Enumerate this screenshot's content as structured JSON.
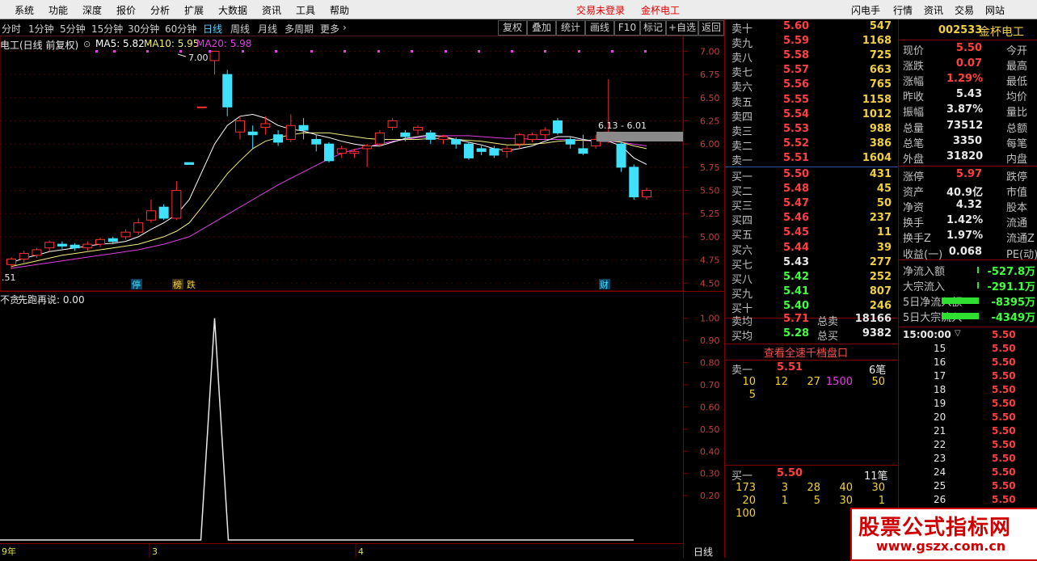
{
  "menu": {
    "items": [
      "系统",
      "功能",
      "深度",
      "报价",
      "分析",
      "扩展",
      "大数据",
      "资讯",
      "工具",
      "帮助"
    ],
    "status": [
      "交易未登录",
      "金杯电工"
    ],
    "right": [
      "闪电手",
      "行情",
      "资讯",
      "交易",
      "网站"
    ]
  },
  "toolbar": {
    "periods": [
      "分时",
      "1分钟",
      "5分钟",
      "15分钟",
      "30分钟",
      "60分钟",
      "日线",
      "周线",
      "月线",
      "多周期",
      "更多"
    ],
    "active": "日线",
    "buttons": [
      "复权",
      "叠加",
      "统计",
      "画线",
      "F10",
      "标记",
      "+自选",
      "返回"
    ]
  },
  "chart_header": {
    "name": "电工(日线 前复权)",
    "ma5": "MA5: 5.82",
    "ma10": "MA10: 5.95",
    "ma20": "MA20: 5.98",
    "high_label": "7.00",
    "range_label": "6.13 - 6.01",
    "low_label": ".51",
    "markers": [
      "停",
      "榜",
      "跌",
      "财"
    ]
  },
  "indicator": {
    "name": "不贪",
    "label": "先跑再说: 0.00",
    "period": "日线"
  },
  "x_axis": [
    "9年",
    "3",
    "4"
  ],
  "chart_data": [
    {
      "type": "candlestick",
      "y_ticks": [
        "7.00",
        "6.75",
        "6.50",
        "6.25",
        "6.00",
        "5.75",
        "5.50",
        "5.25",
        "5.00",
        "4.75",
        "4.50"
      ],
      "ylim": [
        4.45,
        7.1
      ],
      "candles": [
        [
          4.7,
          4.76,
          4.65,
          4.78
        ],
        [
          4.76,
          4.82,
          4.72,
          4.85
        ],
        [
          4.8,
          4.86,
          4.77,
          4.88
        ],
        [
          4.88,
          4.94,
          4.84,
          4.96
        ],
        [
          4.92,
          4.9,
          4.87,
          4.95
        ],
        [
          4.91,
          4.88,
          4.85,
          4.93
        ],
        [
          4.88,
          4.92,
          4.85,
          4.95
        ],
        [
          4.92,
          4.97,
          4.89,
          4.99
        ],
        [
          4.98,
          4.95,
          4.92,
          5.0
        ],
        [
          5.0,
          5.05,
          4.97,
          5.08
        ],
        [
          5.05,
          5.15,
          5.02,
          5.2
        ],
        [
          5.18,
          5.28,
          5.15,
          5.4
        ],
        [
          5.32,
          5.2,
          5.18,
          5.35
        ],
        [
          5.2,
          5.5,
          5.18,
          5.6
        ],
        [
          5.8,
          5.78,
          5.78,
          5.8
        ],
        [
          6.4,
          6.4,
          6.4,
          6.4
        ],
        [
          6.9,
          7.0,
          6.75,
          7.0
        ],
        [
          6.75,
          6.4,
          6.3,
          6.8
        ],
        [
          6.13,
          6.25,
          6.05,
          6.3
        ],
        [
          6.13,
          6.1,
          5.95,
          6.2
        ],
        [
          6.18,
          6.22,
          6.1,
          6.3
        ],
        [
          6.1,
          6.02,
          5.98,
          6.15
        ],
        [
          6.05,
          6.2,
          6.02,
          6.32
        ],
        [
          6.2,
          6.15,
          6.05,
          6.28
        ],
        [
          6.05,
          6.0,
          5.92,
          6.1
        ],
        [
          6.0,
          5.82,
          5.8,
          6.02
        ],
        [
          5.9,
          5.95,
          5.85,
          5.98
        ],
        [
          5.9,
          5.92,
          5.85,
          5.95
        ],
        [
          5.95,
          5.98,
          5.75,
          6.0
        ],
        [
          6.0,
          6.12,
          5.97,
          6.15
        ],
        [
          6.18,
          6.25,
          6.15,
          6.28
        ],
        [
          6.12,
          6.08,
          6.03,
          6.15
        ],
        [
          6.15,
          6.18,
          6.1,
          6.2
        ],
        [
          6.12,
          6.05,
          6.0,
          6.15
        ],
        [
          6.05,
          6.08,
          6.0,
          6.1
        ],
        [
          6.05,
          6.0,
          5.95,
          6.07
        ],
        [
          6.0,
          5.85,
          5.83,
          6.02
        ],
        [
          5.95,
          5.92,
          5.88,
          5.98
        ],
        [
          5.95,
          5.88,
          5.85,
          5.98
        ],
        [
          5.92,
          5.95,
          5.85,
          5.98
        ],
        [
          6.0,
          6.1,
          5.95,
          6.12
        ],
        [
          6.05,
          6.1,
          6.02,
          6.12
        ],
        [
          6.1,
          6.15,
          6.05,
          6.18
        ],
        [
          6.25,
          6.12,
          6.1,
          6.28
        ],
        [
          6.05,
          6.0,
          5.95,
          6.08
        ],
        [
          5.95,
          5.9,
          5.88,
          6.1
        ],
        [
          5.98,
          6.05,
          5.95,
          6.1
        ],
        [
          6.05,
          6.13,
          6.01,
          6.7
        ],
        [
          6.0,
          5.75,
          5.7,
          6.02
        ],
        [
          5.75,
          5.43,
          5.4,
          5.78
        ],
        [
          5.43,
          5.5,
          5.4,
          5.53
        ]
      ],
      "ma5": [
        4.72,
        4.77,
        4.8,
        4.84,
        4.86,
        4.88,
        4.9,
        4.92,
        4.93,
        4.95,
        5.0,
        5.08,
        5.15,
        5.24,
        5.4,
        5.7,
        6.0,
        6.2,
        6.3,
        6.32,
        6.28,
        6.2,
        6.16,
        6.14,
        6.1,
        6.07,
        6.03,
        6.0,
        5.98,
        5.98,
        6.02,
        6.06,
        6.08,
        6.1,
        6.08,
        6.05,
        6.02,
        5.99,
        5.95,
        5.93,
        5.95,
        5.98,
        6.03,
        6.08,
        6.08,
        6.05,
        6.03,
        6.03,
        5.98,
        5.85,
        5.78
      ],
      "ma10": [
        4.68,
        4.71,
        4.74,
        4.77,
        4.8,
        4.82,
        4.84,
        4.86,
        4.88,
        4.9,
        4.92,
        4.96,
        5.0,
        5.06,
        5.15,
        5.32,
        5.5,
        5.68,
        5.82,
        5.95,
        6.03,
        6.07,
        6.1,
        6.12,
        6.12,
        6.12,
        6.1,
        6.08,
        6.06,
        6.05,
        6.05,
        6.05,
        6.05,
        6.06,
        6.06,
        6.05,
        6.04,
        6.03,
        6.01,
        5.99,
        5.99,
        6.0,
        6.01,
        6.03,
        6.04,
        6.04,
        6.04,
        6.04,
        6.02,
        5.98,
        5.95
      ],
      "ma20": [
        4.66,
        4.68,
        4.7,
        4.72,
        4.74,
        4.76,
        4.78,
        4.8,
        4.82,
        4.84,
        4.86,
        4.89,
        4.92,
        4.96,
        5.0,
        5.08,
        5.16,
        5.24,
        5.32,
        5.4,
        5.48,
        5.56,
        5.63,
        5.7,
        5.77,
        5.84,
        5.9,
        5.94,
        5.97,
        6.0,
        6.03,
        6.05,
        6.07,
        6.08,
        6.09,
        6.09,
        6.09,
        6.08,
        6.07,
        6.06,
        6.06,
        6.05,
        6.05,
        6.05,
        6.05,
        6.04,
        6.03,
        6.03,
        6.02,
        6.0,
        5.98
      ]
    },
    {
      "type": "line",
      "y_ticks": [
        "1.00",
        "0.90",
        "0.80",
        "0.70",
        "0.60",
        "0.50",
        "0.40",
        "0.30",
        "0.20"
      ],
      "ylim": [
        0,
        1.05
      ],
      "values": [
        0,
        0,
        0,
        0,
        0,
        0,
        0,
        0,
        0,
        0,
        0,
        0,
        0,
        0,
        0,
        0,
        1,
        0,
        0,
        0,
        0,
        0,
        0,
        0,
        0,
        0,
        0,
        0,
        0,
        0,
        0,
        0,
        0,
        0,
        0,
        0,
        0,
        0,
        0,
        0,
        0,
        0,
        0,
        0,
        0,
        0
      ]
    }
  ],
  "orderbook": {
    "sell": [
      [
        "卖十",
        "5.60",
        "547"
      ],
      [
        "卖九",
        "5.59",
        "1168"
      ],
      [
        "卖八",
        "5.58",
        "725"
      ],
      [
        "卖七",
        "5.57",
        "663"
      ],
      [
        "卖六",
        "5.56",
        "765"
      ],
      [
        "卖五",
        "5.55",
        "1158"
      ],
      [
        "卖四",
        "5.54",
        "1012"
      ],
      [
        "卖三",
        "5.53",
        "988"
      ],
      [
        "卖二",
        "5.52",
        "386"
      ],
      [
        "卖一",
        "5.51",
        "1604"
      ]
    ],
    "buy": [
      [
        "买一",
        "5.50",
        "431"
      ],
      [
        "买二",
        "5.48",
        "45"
      ],
      [
        "买三",
        "5.47",
        "50"
      ],
      [
        "买四",
        "5.46",
        "237"
      ],
      [
        "买五",
        "5.45",
        "11"
      ],
      [
        "买六",
        "5.44",
        "39"
      ],
      [
        "买七",
        "5.43",
        "277"
      ],
      [
        "买八",
        "5.42",
        "252"
      ],
      [
        "买九",
        "5.41",
        "807"
      ],
      [
        "买十",
        "5.40",
        "246"
      ]
    ],
    "avg": [
      [
        "卖均",
        "5.71",
        "总卖",
        "18166"
      ],
      [
        "买均",
        "5.28",
        "总买",
        "9382"
      ]
    ],
    "view_all": "查看全速千档盘口",
    "sell1_queue": {
      "label": "卖一",
      "price": "5.51",
      "count": "6笔",
      "orders": [
        "10",
        "12",
        "27",
        "1500",
        "50",
        "5"
      ]
    },
    "buy1_queue": {
      "label": "买一",
      "price": "5.50",
      "count": "11笔",
      "orders": [
        "173",
        "3",
        "28",
        "40",
        "30",
        "20",
        "1",
        "5",
        "30",
        "1",
        "100"
      ]
    }
  },
  "quote": {
    "code": "002533",
    "name": "金杯电工",
    "rows": [
      [
        "现价",
        "5.50",
        "今开"
      ],
      [
        "涨跌",
        "0.07",
        "最高"
      ],
      [
        "涨幅",
        "1.29%",
        "最低"
      ],
      [
        "昨收",
        "5.43",
        "均价"
      ],
      [
        "振幅",
        "3.87%",
        "量比"
      ],
      [
        "总量",
        "73512",
        "总额"
      ],
      [
        "总笔",
        "3350",
        "每笔"
      ],
      [
        "外盘",
        "31820",
        "内盘"
      ]
    ],
    "rows2": [
      [
        "涨停",
        "5.97",
        "跌停"
      ],
      [
        "资产",
        "40.9亿",
        "市值"
      ],
      [
        "净资",
        "4.32",
        "股本"
      ],
      [
        "换手",
        "1.42%",
        "流通"
      ],
      [
        "换手Z",
        "1.97%",
        "流通Z"
      ],
      [
        "收益(一)",
        "0.068",
        "PE(动)"
      ]
    ],
    "flows": [
      [
        "净流入额",
        "-527.8万"
      ],
      [
        "大宗流入",
        "-291.1万"
      ],
      [
        "5日净流入额",
        "-8395万"
      ],
      [
        "5日大宗流入",
        "-4349万"
      ]
    ]
  },
  "ticks": {
    "times": [
      "15:00:00",
      "15",
      "16",
      "17",
      "18",
      "19",
      "20",
      "21",
      "22",
      "23",
      "24",
      "25",
      "26"
    ],
    "prices": [
      "5.50",
      "5.50",
      "5.50",
      "5.50",
      "5.50",
      "5.50",
      "5.50",
      "5.50",
      "5.50",
      "5.50",
      "5.50",
      "5.50",
      "5.50"
    ]
  },
  "watermark": {
    "cn": "股票公式指标网",
    "url": "www.gszx.com.cn"
  },
  "colors": {
    "up": "#ff3030",
    "down": "#40e0ff",
    "ma5": "#ffffff",
    "ma10": "#f0f080",
    "ma20": "#e040e0"
  }
}
